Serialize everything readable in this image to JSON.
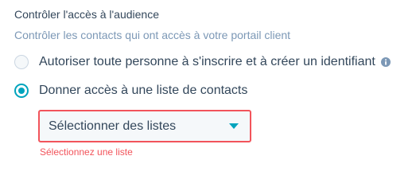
{
  "section": {
    "title": "Contrôler l'accès à l'audience",
    "subtitle": "Contrôler les contacts qui ont accès à votre portail client"
  },
  "options": [
    {
      "label": "Autoriser toute personne à s'inscrire et à créer un identifiant",
      "selected": false,
      "has_info_icon": true
    },
    {
      "label": "Donner accès à une liste de contacts",
      "selected": true,
      "has_info_icon": false
    }
  ],
  "list_select": {
    "value": "Sélectionner des listes",
    "error": "Sélectionnez une liste"
  },
  "icons": {
    "info": "info-icon",
    "dropdown": "caret-down-icon"
  },
  "colors": {
    "text": "#33475b",
    "subtext": "#7c98b6",
    "accent": "#00a4bd",
    "error": "#f2545b",
    "input_bg": "#f5f8fa"
  }
}
